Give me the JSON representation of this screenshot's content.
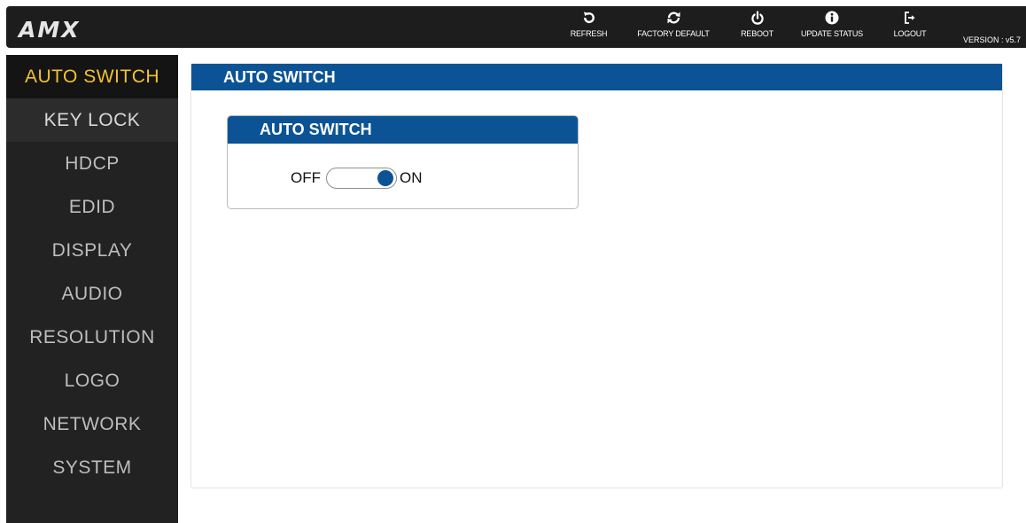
{
  "brand": {
    "logo_text": "AMX"
  },
  "toolbar": {
    "refresh": "REFRESH",
    "factory_default": "FACTORY DEFAULT",
    "reboot": "REBOOT",
    "update_status": "UPDATE STATUS",
    "logout": "LOGOUT",
    "version": "VERSION : v5.7"
  },
  "sidebar": {
    "items": [
      {
        "label": "AUTO SWITCH",
        "state": "active"
      },
      {
        "label": "KEY LOCK",
        "state": "hover"
      },
      {
        "label": "HDCP",
        "state": "normal"
      },
      {
        "label": "EDID",
        "state": "normal"
      },
      {
        "label": "DISPLAY",
        "state": "normal"
      },
      {
        "label": "AUDIO",
        "state": "normal"
      },
      {
        "label": "RESOLUTION",
        "state": "normal"
      },
      {
        "label": "LOGO",
        "state": "normal"
      },
      {
        "label": "NETWORK",
        "state": "normal"
      },
      {
        "label": "SYSTEM",
        "state": "normal"
      }
    ]
  },
  "main": {
    "title": "AUTO SWITCH",
    "card": {
      "title": "AUTO SWITCH",
      "off_label": "OFF",
      "on_label": "ON",
      "value": "ON"
    }
  },
  "colors": {
    "accent_blue": "#0b5394",
    "active_nav_text": "#f1c232",
    "topbar_bg": "#1d1d1d",
    "sidebar_bg": "#222222"
  },
  "icons": [
    "refresh-icon",
    "factory-default-icon",
    "reboot-icon",
    "update-status-icon",
    "logout-icon"
  ]
}
